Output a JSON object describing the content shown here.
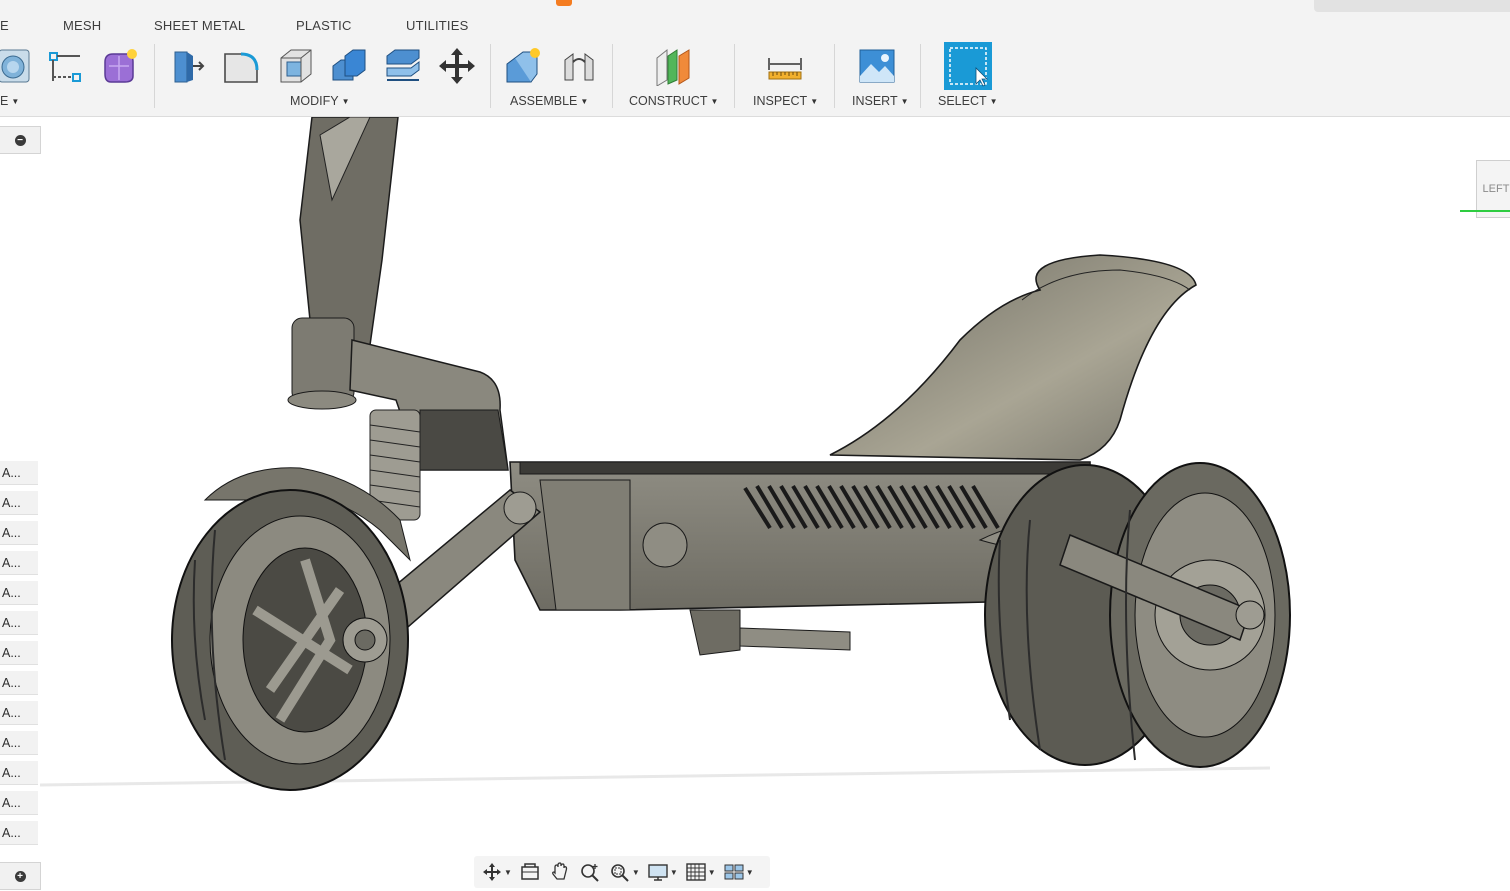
{
  "toolbar": {
    "tabs": [
      "E",
      "MESH",
      "SHEET METAL",
      "PLASTIC",
      "UTILITIES"
    ],
    "groups": {
      "create": "E",
      "modify": "MODIFY",
      "assemble": "ASSEMBLE",
      "construct": "CONSTRUCT",
      "inspect": "INSPECT",
      "insert": "INSERT",
      "select": "SELECT"
    },
    "icons": {
      "create": [
        "revolve-icon",
        "sketch-dimension-icon",
        "create-form-icon"
      ],
      "modify": [
        "press-pull-icon",
        "fillet-icon",
        "shell-icon",
        "combine-icon",
        "offset-face-icon",
        "move-icon"
      ],
      "assemble": [
        "new-component-icon",
        "joint-icon"
      ],
      "construct": [
        "offset-plane-icon"
      ],
      "inspect": [
        "measure-icon"
      ],
      "insert": [
        "insert-image-icon"
      ],
      "select": [
        "window-select-icon"
      ]
    }
  },
  "browser": {
    "items": [
      "A...",
      "A...",
      "A...",
      "A...",
      "A...",
      "A...",
      "A...",
      "A...",
      "A...",
      "A...",
      "A...",
      "A...",
      "A..."
    ]
  },
  "viewcube": {
    "label": "LEFT"
  },
  "navbar": {
    "icons": [
      "orbit-icon",
      "look-at-icon",
      "pan-icon",
      "zoom-icon",
      "fit-icon",
      "display-settings-icon",
      "grid-icon",
      "viewports-icon"
    ]
  },
  "colors": {
    "toolbar_bg": "#f3f3f3",
    "accent_blue": "#1a9ad6",
    "body_grey": "#7e7c72"
  }
}
